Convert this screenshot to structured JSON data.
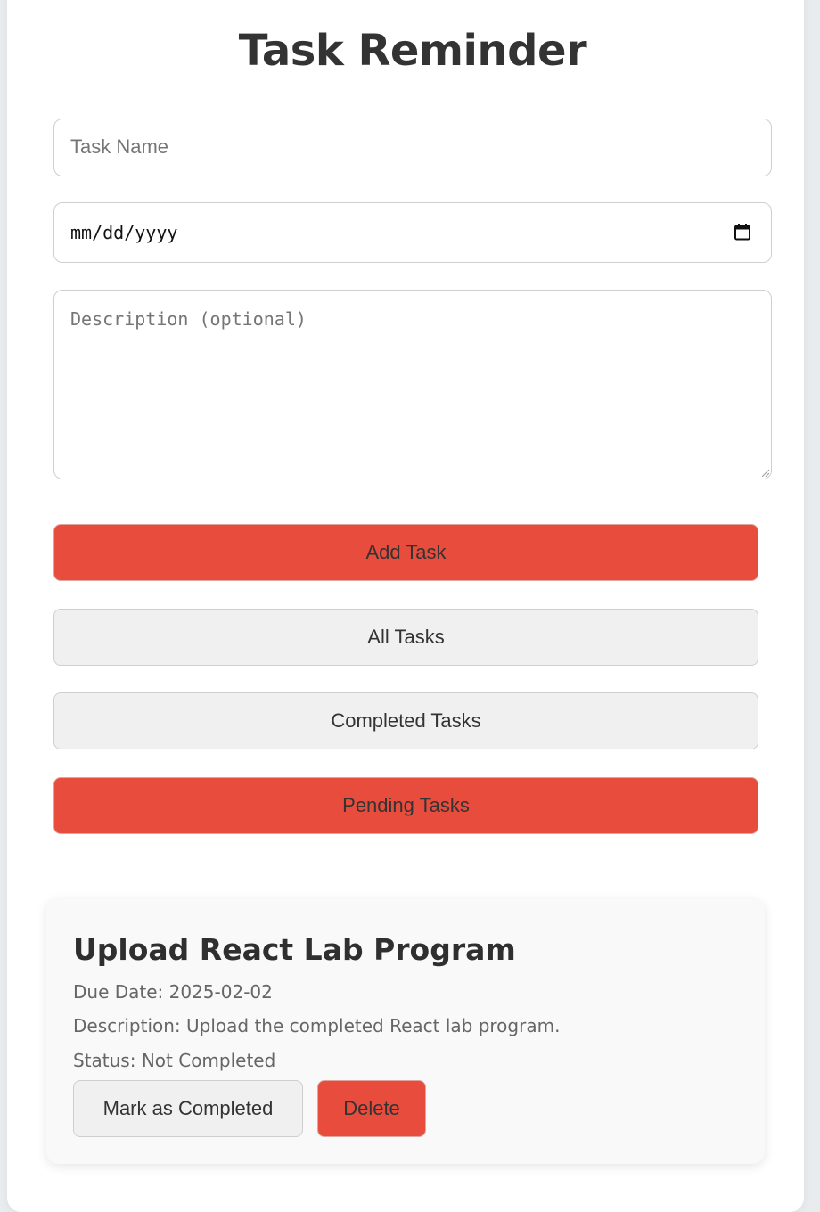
{
  "app": {
    "title": "Task Reminder"
  },
  "form": {
    "task_name": {
      "value": "",
      "placeholder": "Task Name"
    },
    "due_date": {
      "value": "",
      "placeholder": "mm/dd/yyyy"
    },
    "description": {
      "value": "",
      "placeholder": "Description (optional)"
    },
    "add_button": "Add Task"
  },
  "filters": {
    "all": "All Tasks",
    "completed": "Completed Tasks",
    "pending": "Pending Tasks",
    "active": "pending"
  },
  "tasks": [
    {
      "title": "Upload React Lab Program",
      "due_line": "Due Date: 2025-02-02",
      "description_line": "Description: Upload the completed React lab program.",
      "status_line": "Status: Not Completed",
      "mark_button": "Mark as Completed",
      "delete_button": "Delete"
    }
  ],
  "colors": {
    "accent": "#e74c3c",
    "button_neutral": "#f0f0f0",
    "card_bg": "#f9f9f9",
    "page_bg": "#e9ecef",
    "text": "#333333"
  },
  "icons": {
    "date_picker": "calendar-icon",
    "textarea_resize": "resize-grip-icon"
  }
}
